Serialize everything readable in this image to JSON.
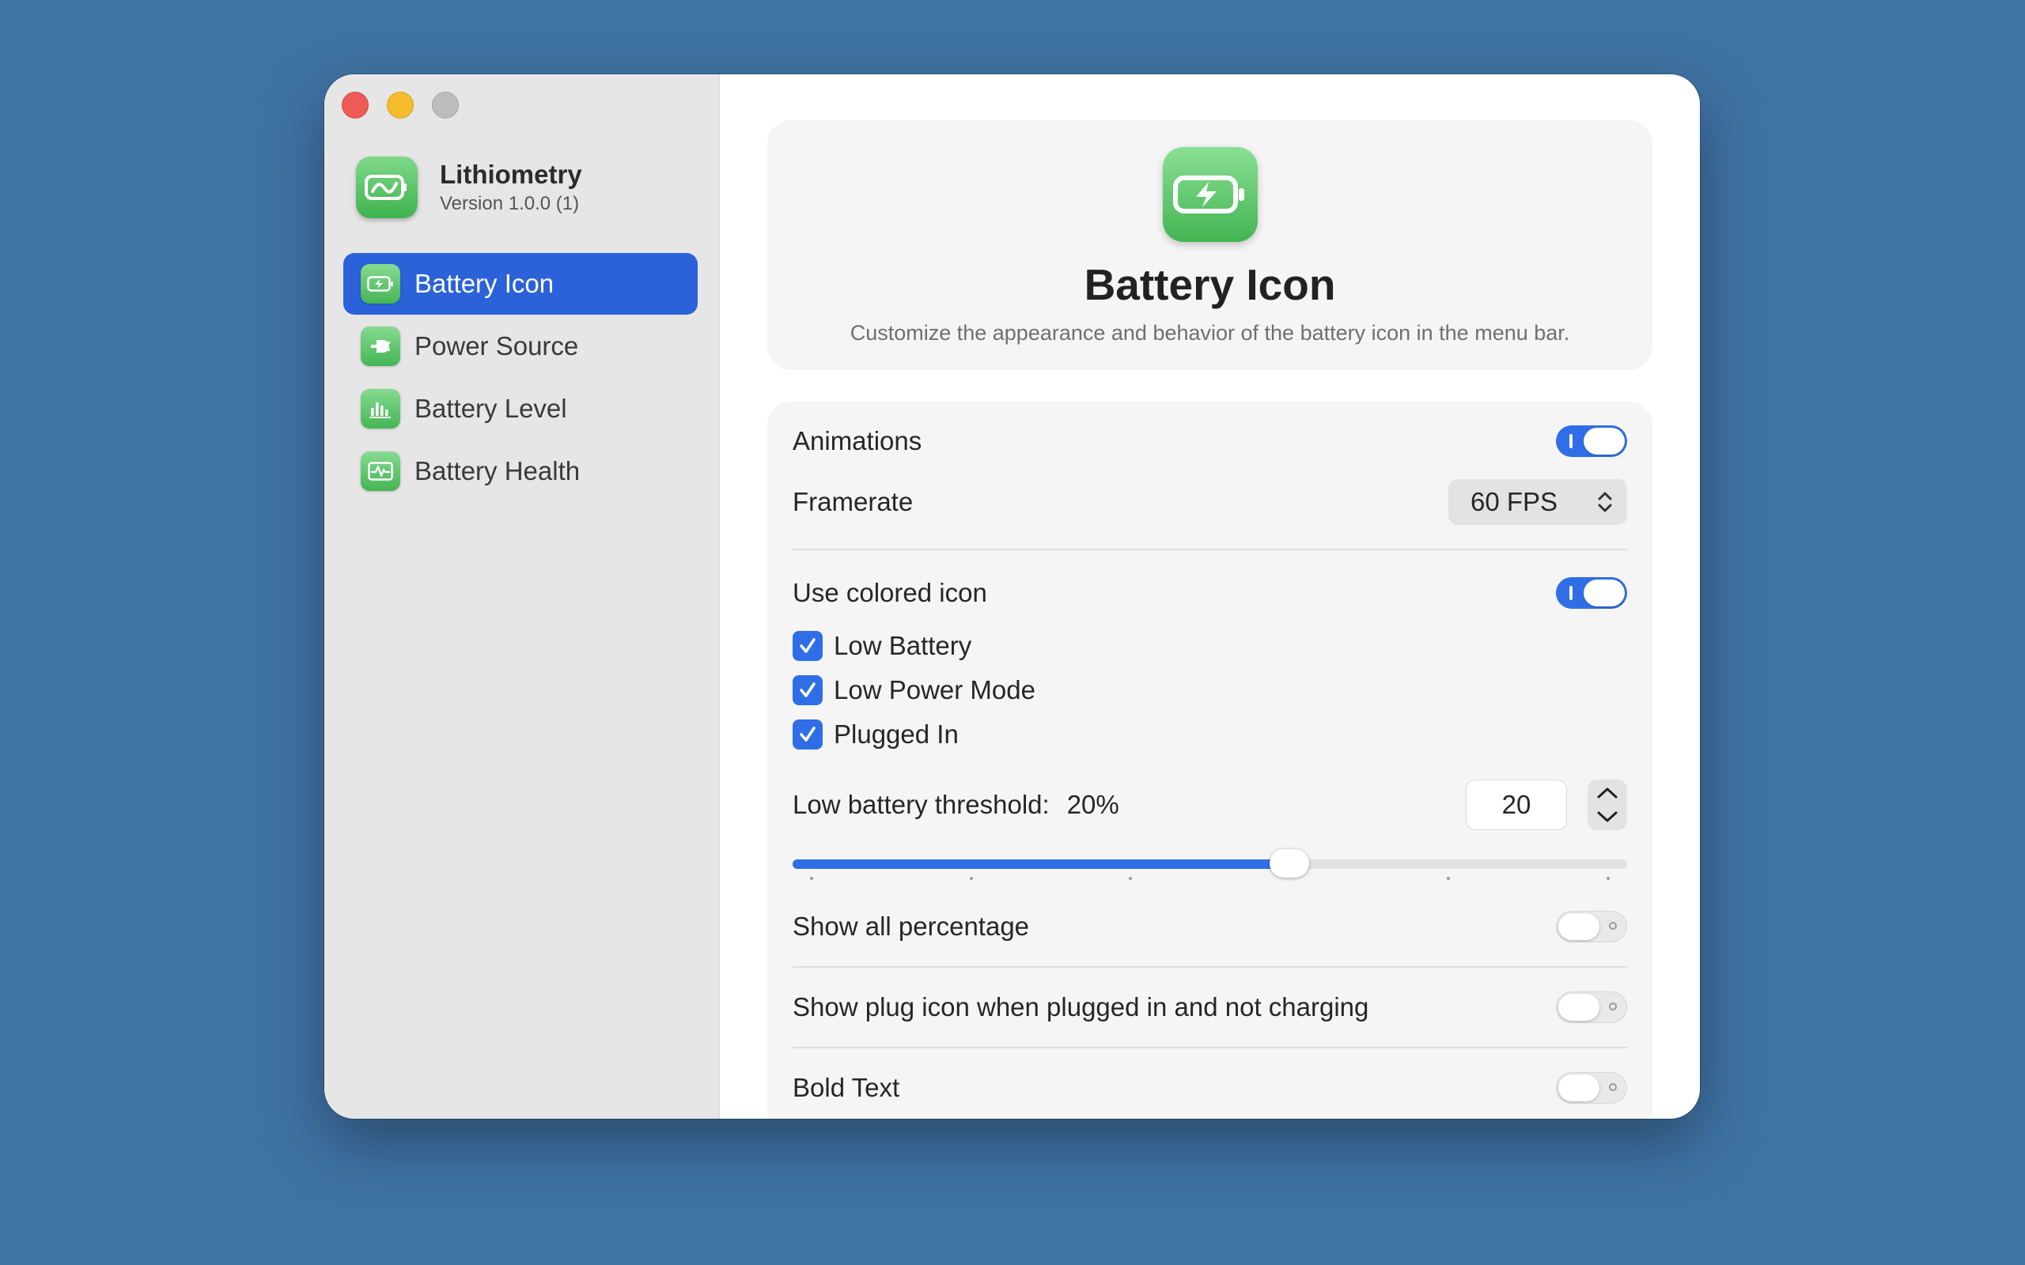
{
  "app": {
    "name": "Lithiometry",
    "version": "Version 1.0.0 (1)"
  },
  "sidebar": {
    "items": [
      {
        "label": "Battery Icon",
        "icon": "battery-charging-icon",
        "selected": true
      },
      {
        "label": "Power Source",
        "icon": "plug-icon",
        "selected": false
      },
      {
        "label": "Battery Level",
        "icon": "bar-chart-icon",
        "selected": false
      },
      {
        "label": "Battery Health",
        "icon": "heartbeat-icon",
        "selected": false
      }
    ]
  },
  "header": {
    "title": "Battery Icon",
    "subtitle": "Customize the appearance and behavior of the battery icon in the menu bar.",
    "icon": "battery-charging-icon"
  },
  "settings": {
    "animations": {
      "label": "Animations",
      "on": true
    },
    "framerate": {
      "label": "Framerate",
      "value": "60 FPS"
    },
    "colored_icon": {
      "label": "Use colored icon",
      "on": true
    },
    "checks": [
      {
        "label": "Low Battery",
        "checked": true
      },
      {
        "label": "Low Power Mode",
        "checked": true
      },
      {
        "label": "Plugged In",
        "checked": true
      }
    ],
    "threshold": {
      "label": "Low battery threshold:",
      "display": "20%",
      "value": "20",
      "slider_fraction": 0.595
    },
    "show_all_percentage": {
      "label": "Show all percentage",
      "on": false
    },
    "show_plug_icon": {
      "label": "Show plug icon when plugged in and not charging",
      "on": false
    },
    "bold_text": {
      "label": "Bold Text",
      "on": false
    }
  },
  "colors": {
    "accent": "#2f6ee6",
    "sidebar_selected": "#2c62d9",
    "app_green": "#43b552",
    "desktop": "#3f73a5"
  }
}
